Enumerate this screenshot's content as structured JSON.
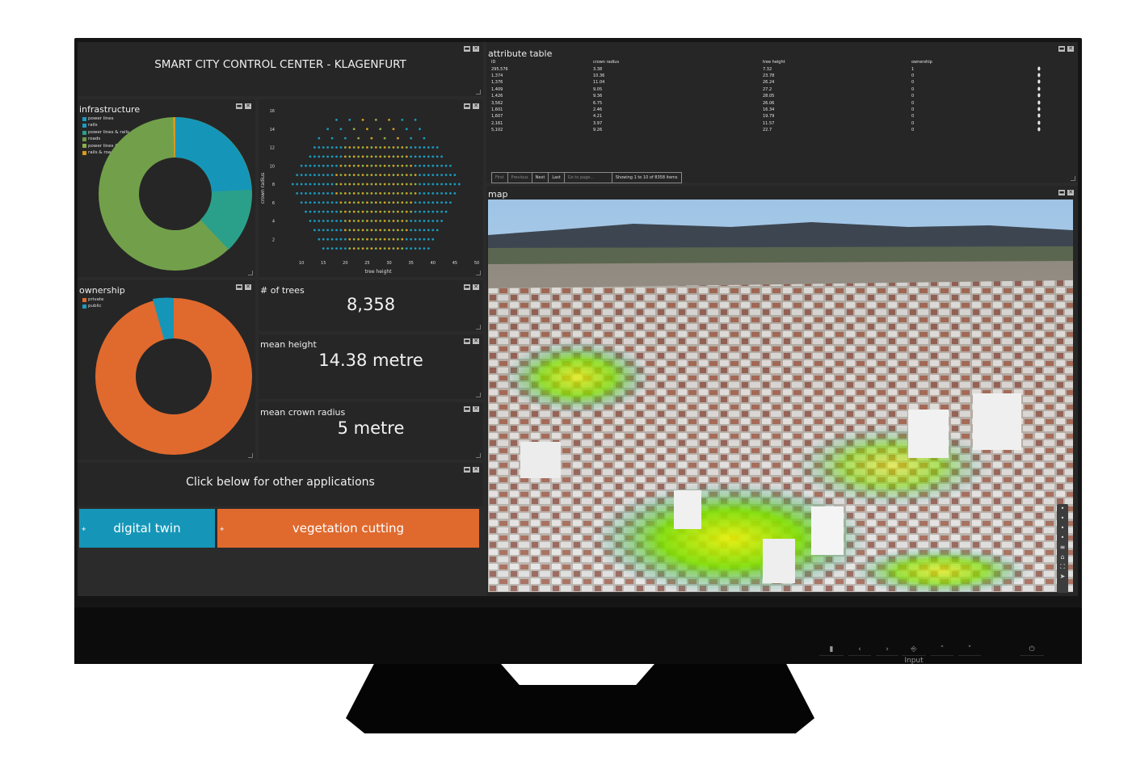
{
  "dashboard": {
    "title": "SMART CITY CONTROL CENTER - KLAGENFURT",
    "window_controls": {
      "minimize": "▬",
      "close": "✕"
    }
  },
  "infrastructure": {
    "title": "infrastructure",
    "legend": [
      {
        "label": "power lines",
        "color": "#1b9bbf"
      },
      {
        "label": "rails",
        "color": "#1b9bbf"
      },
      {
        "label": "power lines & rails",
        "color": "#2aa08a"
      },
      {
        "label": "roads",
        "color": "#6a9a4a"
      },
      {
        "label": "power lines & roads",
        "color": "#8ab04a"
      },
      {
        "label": "rails & roads",
        "color": "#d79a1e"
      }
    ]
  },
  "scatter": {
    "chart_data": {
      "type": "scatter",
      "xlabel": "tree height",
      "ylabel": "crown radius",
      "x_ticks": [
        10,
        15,
        20,
        25,
        30,
        35,
        40,
        45,
        50
      ],
      "y_ticks": [
        2,
        4,
        6,
        8,
        10,
        12,
        14,
        16
      ],
      "xlim": [
        5,
        50
      ],
      "ylim": [
        0,
        16
      ]
    }
  },
  "ownership": {
    "title": "ownership",
    "legend": [
      {
        "label": "private",
        "color": "#e06a2e"
      },
      {
        "label": "public",
        "color": "#1b9bbf"
      }
    ],
    "chart_data": {
      "type": "pie",
      "categories": [
        "private",
        "public"
      ],
      "values": [
        93,
        7
      ]
    }
  },
  "stats": {
    "trees_label": "# of trees",
    "trees_value": "8,358",
    "height_label": "mean height",
    "height_value": "14.38 metre",
    "radius_label": "mean crown radius",
    "radius_value": "5 metre"
  },
  "apps": {
    "caption": "Click below for other applications",
    "digital_twin": "digital twin",
    "vegetation_cutting": "vegetation cutting",
    "digital_twin_color": "#1596b8",
    "vegetation_color": "#e06a2e"
  },
  "attribute_table": {
    "title": "attribute table",
    "columns": [
      "ID",
      "crown radius",
      "tree height",
      "ownership"
    ],
    "rows": [
      [
        "295,576",
        "3.38",
        "7.32",
        "1"
      ],
      [
        "1,374",
        "10.36",
        "23.78",
        "0"
      ],
      [
        "1,376",
        "11.04",
        "26.24",
        "0"
      ],
      [
        "1,409",
        "9.05",
        "27.2",
        "0"
      ],
      [
        "1,426",
        "9.36",
        "28.05",
        "0"
      ],
      [
        "3,562",
        "6.75",
        "26.06",
        "0"
      ],
      [
        "1,601",
        "2.46",
        "16.34",
        "0"
      ],
      [
        "1,607",
        "4.21",
        "19.79",
        "0"
      ],
      [
        "2,161",
        "3.97",
        "11.57",
        "0"
      ],
      [
        "5,102",
        "9.26",
        "22.7",
        "0"
      ]
    ],
    "pager": {
      "first": "First",
      "previous": "Previous",
      "next": "Next",
      "last": "Last",
      "goto": "Go to page...",
      "status": "Showing 1 to 10 of 8358 items"
    }
  },
  "map": {
    "title": "map"
  },
  "monitor": {
    "controls": [
      "▮",
      "‹",
      "›",
      "⎆ Input",
      "˄",
      "˅",
      "⏻"
    ]
  }
}
